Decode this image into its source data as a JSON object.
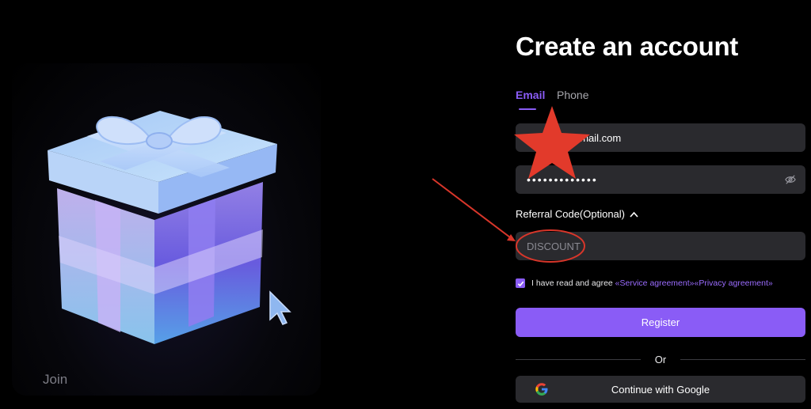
{
  "hero": {
    "join_text": "Join"
  },
  "form": {
    "title": "Create an account",
    "tabs": [
      {
        "label": "Email",
        "active": true
      },
      {
        "label": "Phone",
        "active": false
      }
    ],
    "email_value": "gmail.com",
    "password_mask": "•••••••••••••",
    "referral_label": "Referral Code(Optional)",
    "referral_value": "DISCOUNT",
    "agree_text": "I have read and agree",
    "service_link": "«Service agreement»",
    "privacy_link": "«Privacy agreement»",
    "register_label": "Register",
    "or_text": "Or",
    "google_label": "Continue with Google"
  },
  "colors": {
    "accent": "#8a5cf6",
    "background": "#000000",
    "field": "#2a2a2e",
    "annotation_red": "#e0362a"
  },
  "icons": [
    "gift-icon",
    "cursor-arrow-icon",
    "eye-off-icon",
    "chevron-up-icon",
    "check-icon",
    "google-g-icon",
    "star-annotation",
    "arrow-annotation"
  ]
}
